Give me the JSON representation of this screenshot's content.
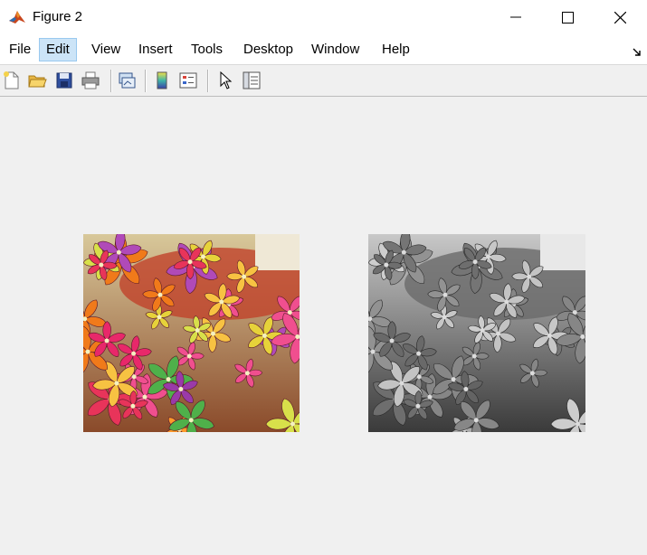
{
  "window": {
    "title": "Figure 2",
    "icon": "matlab-logo-icon"
  },
  "menubar": {
    "items": [
      {
        "label": "File"
      },
      {
        "label": "Edit",
        "active": true
      },
      {
        "label": "View"
      },
      {
        "label": "Insert"
      },
      {
        "label": "Tools"
      },
      {
        "label": "Desktop"
      },
      {
        "label": "Window"
      },
      {
        "label": "Help"
      }
    ]
  },
  "toolbar": {
    "buttons": [
      {
        "icon": "new-figure-icon"
      },
      {
        "icon": "open-file-icon"
      },
      {
        "icon": "save-icon"
      },
      {
        "icon": "print-icon"
      },
      {
        "icon": "link-plot-icon"
      },
      {
        "icon": "insert-colorbar-icon"
      },
      {
        "icon": "insert-legend-icon"
      },
      {
        "icon": "edit-plot-pointer-icon"
      },
      {
        "icon": "property-inspector-icon"
      }
    ]
  },
  "figure": {
    "images": [
      {
        "name": "original-color-image",
        "colormap": "rgb"
      },
      {
        "name": "grayscale-image",
        "colormap": "gray"
      }
    ]
  }
}
